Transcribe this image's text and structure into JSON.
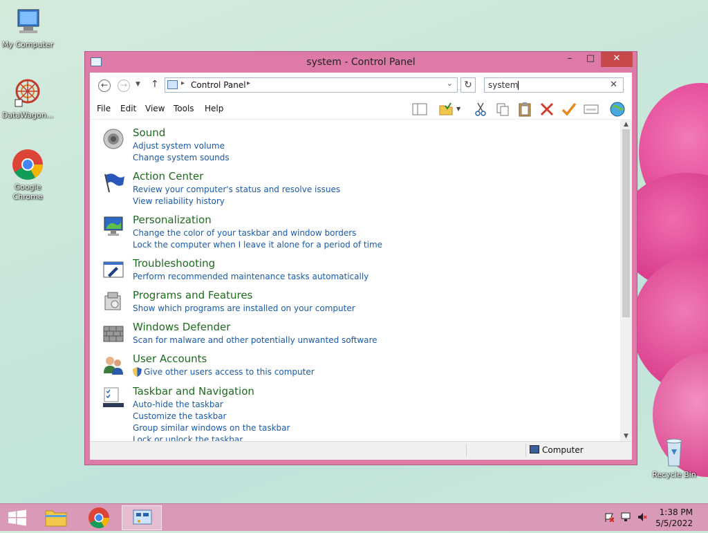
{
  "desktop": {
    "icons": [
      {
        "label": "My Computer"
      },
      {
        "label": "DataWagon..."
      },
      {
        "label": "Google Chrome"
      },
      {
        "label": "Recycle Bin"
      }
    ]
  },
  "window": {
    "title": "system - Control Panel",
    "controls": {
      "minimize": "–",
      "maximize": "□",
      "close": "✕"
    }
  },
  "address": {
    "breadcrumb": "Control Panel",
    "search_value": "system",
    "back_icon": "←",
    "forward_icon": "→",
    "up_icon": "↑",
    "refresh_icon": "↻",
    "clear_icon": "✕"
  },
  "menu": {
    "items": [
      "File",
      "Edit",
      "View",
      "Tools",
      "Help"
    ]
  },
  "categories": [
    {
      "title": "Sound",
      "icon": "speaker-icon",
      "links": [
        "Adjust system volume",
        "Change system sounds"
      ]
    },
    {
      "title": "Action Center",
      "icon": "flag-icon",
      "links": [
        "Review your computer's status and resolve issues",
        "View reliability history"
      ]
    },
    {
      "title": "Personalization",
      "icon": "monitor-icon",
      "links": [
        "Change the color of your taskbar and window borders",
        "Lock the computer when I leave it alone for a period of time"
      ]
    },
    {
      "title": "Troubleshooting",
      "icon": "troubleshoot-icon",
      "links": [
        "Perform recommended maintenance tasks automatically"
      ]
    },
    {
      "title": "Programs and Features",
      "icon": "programs-icon",
      "links": [
        "Show which programs are installed on your computer"
      ]
    },
    {
      "title": "Windows Defender",
      "icon": "defender-wall-icon",
      "links": [
        "Scan for malware and other potentially unwanted software"
      ]
    },
    {
      "title": "User Accounts",
      "icon": "users-icon",
      "links": [
        "Give other users access to this computer"
      ]
    },
    {
      "title": "Taskbar and Navigation",
      "icon": "taskbar-icon",
      "links": [
        "Auto-hide the taskbar",
        "Customize the taskbar",
        "Group similar windows on the taskbar",
        "Lock or unlock the taskbar"
      ]
    }
  ],
  "status": {
    "location": "Computer"
  },
  "taskbar": {
    "clock_time": "1:38 PM",
    "clock_date": "5/5/2022"
  }
}
